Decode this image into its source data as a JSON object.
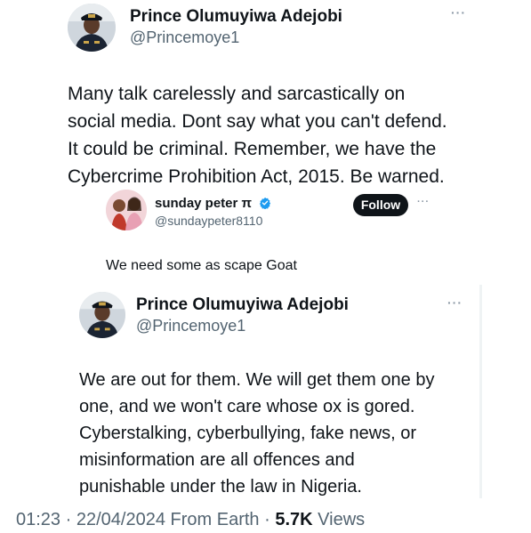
{
  "main_tweet": {
    "author_name": "Prince Olumuyiwa Adejobi",
    "author_handle": "@Princemoye1",
    "text_lines": [
      "Many talk carelessly and sarcastically on",
      "social media. Dont say what you can't defend.",
      "It could be criminal. Remember, we have the",
      "Cybercrime Prohibition Act, 2015. Be warned."
    ],
    "more_icon": "ellipsis-icon"
  },
  "reply": {
    "author_name": "sunday peter π",
    "author_handle": "@sundaypeter8110",
    "follow_label": "Follow",
    "text": "We need some as scape Goat",
    "verified_icon": "verified-badge-icon",
    "more_icon": "ellipsis-icon"
  },
  "quoted_tweet": {
    "author_name": "Prince Olumuyiwa Adejobi",
    "author_handle": "@Princemoye1",
    "text_lines": [
      "We are out for them. We will get them one by",
      "one, and we won't care whose ox is gored.",
      "Cyberstalking, cyberbullying, fake news, or",
      "misinformation are all offences and",
      "punishable under the law in Nigeria."
    ],
    "more_icon": "ellipsis-icon"
  },
  "footer": {
    "time": "01:23",
    "separator": "·",
    "date": "22/04/2024",
    "source": "From Earth",
    "views_count": "5.7K",
    "views_label": "Views"
  },
  "colors": {
    "text_primary": "#0f1419",
    "text_secondary": "#536471",
    "verified_blue": "#1d9bf0",
    "follow_bg": "#0f1419"
  }
}
